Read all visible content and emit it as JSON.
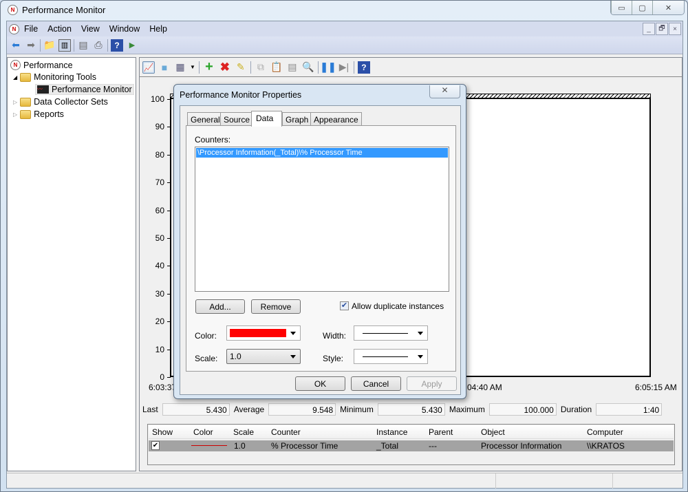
{
  "window": {
    "title": "Performance Monitor",
    "minimize": "▭",
    "maximize": "▢",
    "close": "✕"
  },
  "menu": [
    "File",
    "Action",
    "View",
    "Window",
    "Help"
  ],
  "mdi_controls": [
    "_",
    "🗗",
    "×"
  ],
  "tree": {
    "root": "Performance",
    "items": [
      {
        "label": "Monitoring Tools",
        "expanded": true
      },
      {
        "label": "Performance Monitor",
        "selected": true
      },
      {
        "label": "Data Collector Sets"
      },
      {
        "label": "Reports"
      }
    ]
  },
  "graph": {
    "y_ticks": [
      "100",
      "90",
      "80",
      "70",
      "60",
      "50",
      "40",
      "30",
      "20",
      "10",
      "0"
    ],
    "x_labels": [
      "6:03:37 AM",
      "6:04:40 AM",
      "6:05:15 AM"
    ],
    "ylim": [
      0,
      100
    ]
  },
  "stats": {
    "last_label": "Last",
    "last": "5.430",
    "average_label": "Average",
    "average": "9.548",
    "minimum_label": "Minimum",
    "minimum": "5.430",
    "maximum_label": "Maximum",
    "maximum": "100.000",
    "duration_label": "Duration",
    "duration": "1:40"
  },
  "legend": {
    "headers": [
      "Show",
      "Color",
      "Scale",
      "Counter",
      "Instance",
      "Parent",
      "Object",
      "Computer"
    ],
    "row": {
      "show": true,
      "color": "#cc0000",
      "scale": "1.0",
      "counter": "% Processor Time",
      "instance": "_Total",
      "parent": "---",
      "object": "Processor Information",
      "computer": "\\\\KRATOS"
    }
  },
  "dialog": {
    "title": "Performance Monitor Properties",
    "tabs": [
      "General",
      "Source",
      "Data",
      "Graph",
      "Appearance"
    ],
    "active_tab": "Data",
    "counters_label": "Counters:",
    "counters": [
      "\\Processor Information(_Total)\\% Processor Time"
    ],
    "add": "Add...",
    "remove": "Remove",
    "allow_duplicates": "Allow duplicate instances",
    "allow_duplicates_checked": true,
    "color_label": "Color:",
    "color_value": "#ff0000",
    "scale_label": "Scale:",
    "scale_value": "1.0",
    "width_label": "Width:",
    "style_label": "Style:",
    "ok": "OK",
    "cancel": "Cancel",
    "apply": "Apply"
  }
}
